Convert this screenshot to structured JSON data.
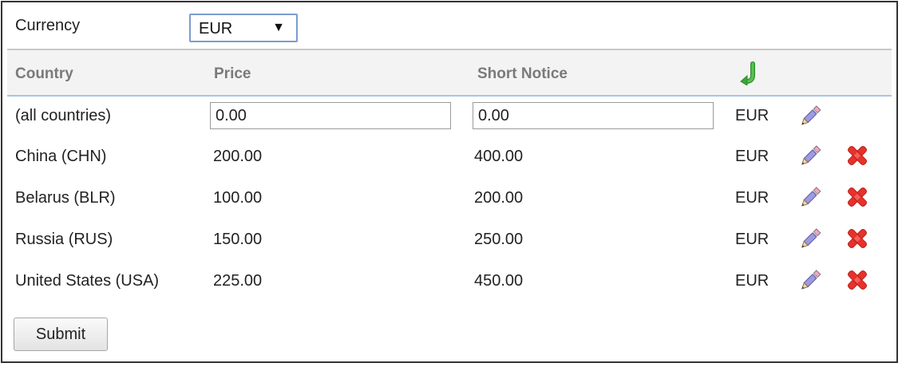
{
  "currency": {
    "label": "Currency",
    "selected": "EUR"
  },
  "table": {
    "headers": {
      "country": "Country",
      "price": "Price",
      "short_notice": "Short Notice"
    },
    "default_row": {
      "country": "(all countries)",
      "price": "0.00",
      "short_notice": "0.00",
      "currency": "EUR"
    },
    "rows": [
      {
        "country": "China (CHN)",
        "price": "200.00",
        "short_notice": "400.00",
        "currency": "EUR"
      },
      {
        "country": "Belarus (BLR)",
        "price": "100.00",
        "short_notice": "200.00",
        "currency": "EUR"
      },
      {
        "country": "Russia (RUS)",
        "price": "150.00",
        "short_notice": "250.00",
        "currency": "EUR"
      },
      {
        "country": "United States (USA)",
        "price": "225.00",
        "short_notice": "450.00",
        "currency": "EUR"
      }
    ]
  },
  "icons": {
    "reset": "undo-arrow-icon",
    "edit": "pencil-icon",
    "delete": "delete-x-icon"
  },
  "colors": {
    "reset_green": "#3aa63a",
    "delete_red": "#e8312b",
    "header_border": "#a9c4e4",
    "select_border": "#7a9ccf"
  },
  "submit_label": "Submit"
}
